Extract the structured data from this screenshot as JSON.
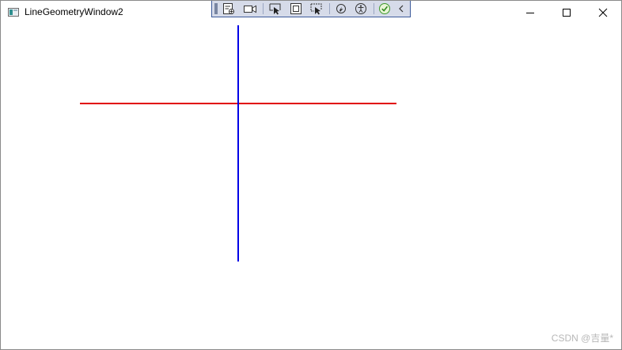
{
  "window": {
    "title": "LineGeometryWindow2",
    "icon": "app-window-icon"
  },
  "caption_buttons": {
    "minimize_icon": "minimize-icon",
    "maximize_icon": "maximize-icon",
    "close_icon": "close-icon"
  },
  "dev_toolbar": {
    "items": [
      "go-to-live-visual-tree-icon",
      "camera-icon",
      "select-element-icon",
      "display-layout-adorners-icon",
      "track-focused-element-icon",
      "hot-reload-icon",
      "accessibility-icon",
      "binding-check-icon",
      "collapse-chevron-icon"
    ]
  },
  "canvas": {
    "lines": [
      {
        "name": "horizontal-line",
        "color": "#e10000"
      },
      {
        "name": "vertical-line",
        "color": "#0000e6"
      }
    ]
  },
  "watermark": "CSDN @吉量*"
}
